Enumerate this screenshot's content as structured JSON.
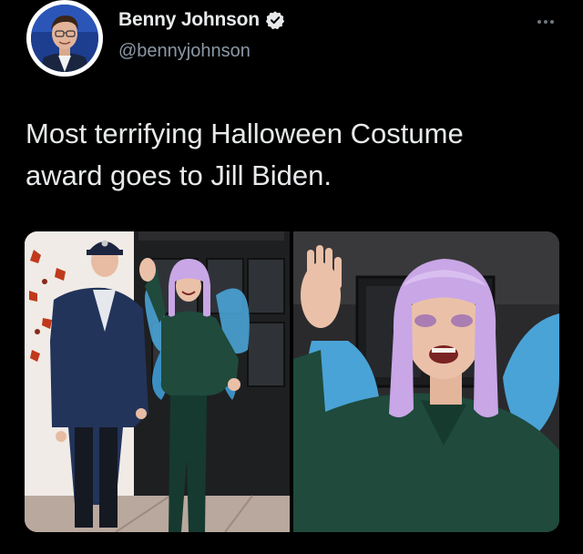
{
  "tweet": {
    "author": {
      "display_name": "Benny Johnson",
      "handle": "@bennyjohnson",
      "verified": true,
      "verified_icon": "verified-badge-icon",
      "avatar_icon": "avatar-photo"
    },
    "more_icon": "more-options-icon",
    "text_line1": "Most terrifying Halloween Costume",
    "text_line2": "award goes to Jill Biden.",
    "media": [
      {
        "kind": "photo",
        "description_icon": "photo-couple-at-door"
      },
      {
        "kind": "photo",
        "description_icon": "photo-closeup-costume"
      }
    ]
  },
  "colors": {
    "background": "#000000",
    "text_primary": "#e7e9ea",
    "text_secondary": "#8b98a5",
    "wig_lavender": "#c9a6e6",
    "wing_blue": "#4aa3d6",
    "blouse_green": "#1f4a3c"
  }
}
